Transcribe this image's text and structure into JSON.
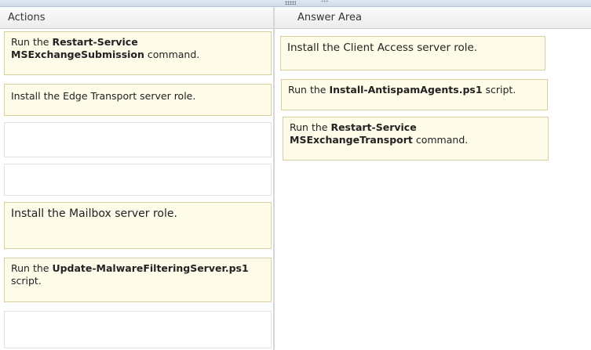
{
  "actions_pane": {
    "title": "Actions",
    "items": [
      {
        "prefix": "Run the ",
        "bold": "Restart-Service MSExchangeSubmission",
        "suffix": " command."
      },
      {
        "prefix": "Install the Edge Transport server role.",
        "bold": "",
        "suffix": ""
      },
      {
        "prefix": "",
        "bold": "",
        "suffix": ""
      },
      {
        "prefix": "",
        "bold": "",
        "suffix": ""
      },
      {
        "prefix": "Install the Mailbox server role.",
        "bold": "",
        "suffix": ""
      },
      {
        "prefix": "Run the ",
        "bold": "Update-MalwareFilteringServer.ps1",
        "suffix": " script."
      },
      {
        "prefix": "",
        "bold": "",
        "suffix": ""
      }
    ]
  },
  "answer_pane": {
    "title": "Answer Area",
    "items": [
      {
        "prefix": "Install the Client Access server role.",
        "bold": "",
        "suffix": ""
      },
      {
        "prefix": "Run the ",
        "bold": "Install-AntispamAgents.ps1",
        "suffix": " script."
      },
      {
        "prefix": "Run the ",
        "bold": "Restart-Service MSExchangeTransport",
        "suffix": " command."
      }
    ]
  }
}
